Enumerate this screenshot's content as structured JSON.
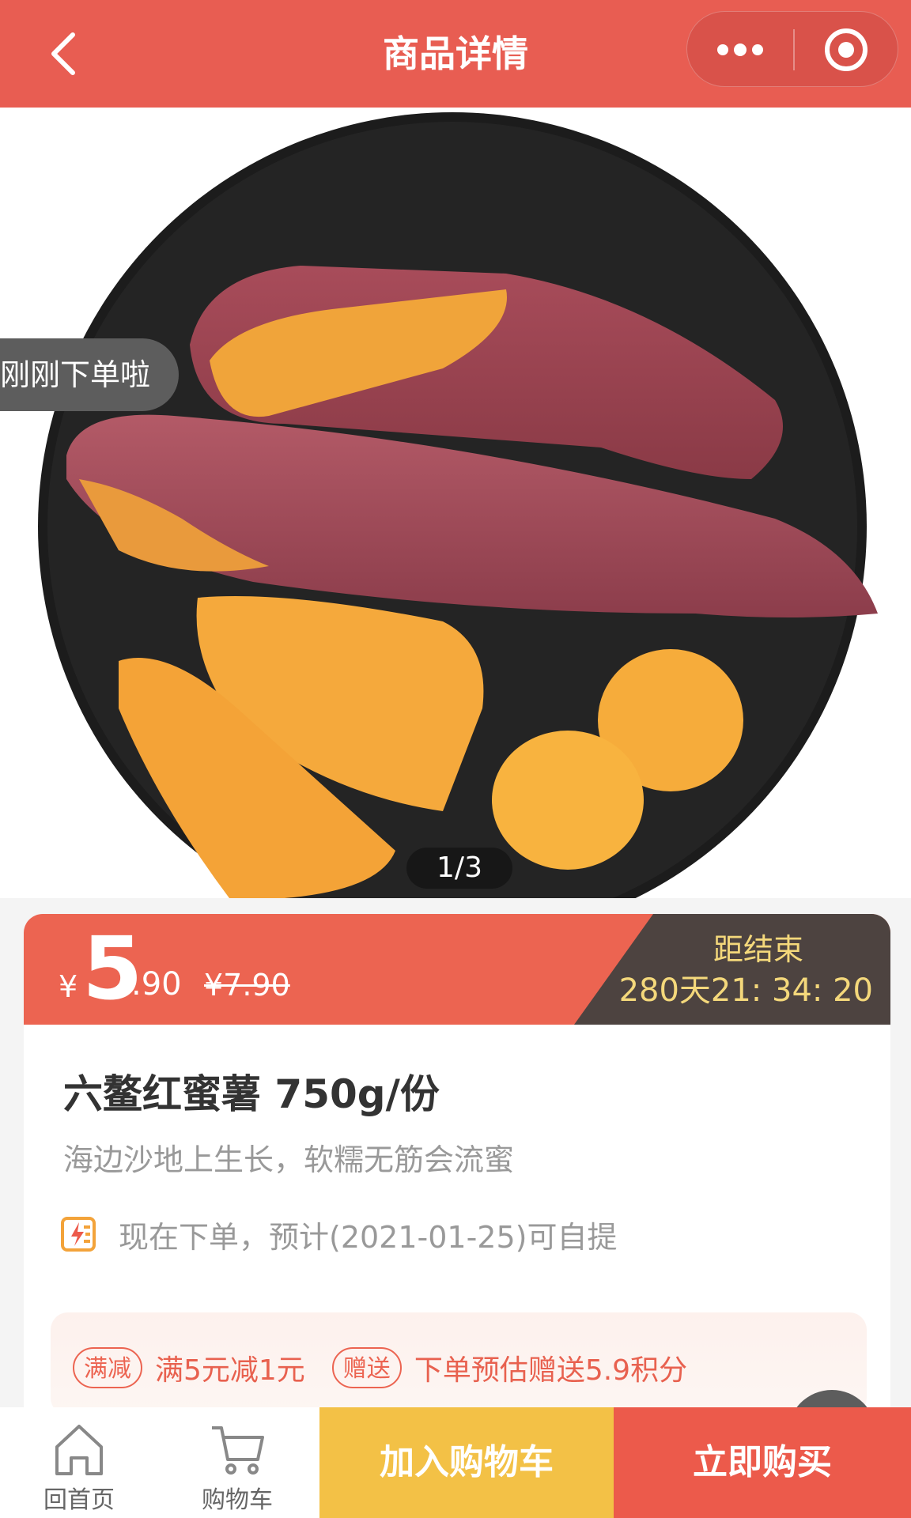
{
  "header": {
    "title": "商品详情",
    "accent": "#e85d52"
  },
  "hero": {
    "toast": "刚刚下单啦",
    "pager": "1/3"
  },
  "price": {
    "currency": "¥",
    "integer": "5",
    "decimal": ".90",
    "original": "¥7.90",
    "countdown_label": "距结束",
    "countdown": "280天21: 34: 20"
  },
  "product": {
    "name": "六鳌红蜜薯 750g/份",
    "description": "海边沙地上生长，软糯无筋会流蜜",
    "delivery": "现在下单，预计(2021-01-25)可自提"
  },
  "promotions": [
    {
      "tag": "满减",
      "text": "满5元减1元"
    },
    {
      "tag": "赠送",
      "text": "下单预估赠送5.9积分"
    }
  ],
  "bottom_nav": {
    "home": "回首页",
    "cart": "购物车",
    "add_to_cart": "加入购物车",
    "buy_now": "立即购买"
  },
  "colors": {
    "price_bar": "#ec6451",
    "countdown_bg": "#4d4340",
    "countdown_text": "#f4d87b",
    "add_to_cart": "#f3c146",
    "buy_now": "#ec5a4b"
  },
  "icons": [
    "back-icon",
    "more-icon",
    "capsule-close-icon",
    "delivery-icon",
    "home-icon",
    "cart-icon"
  ]
}
